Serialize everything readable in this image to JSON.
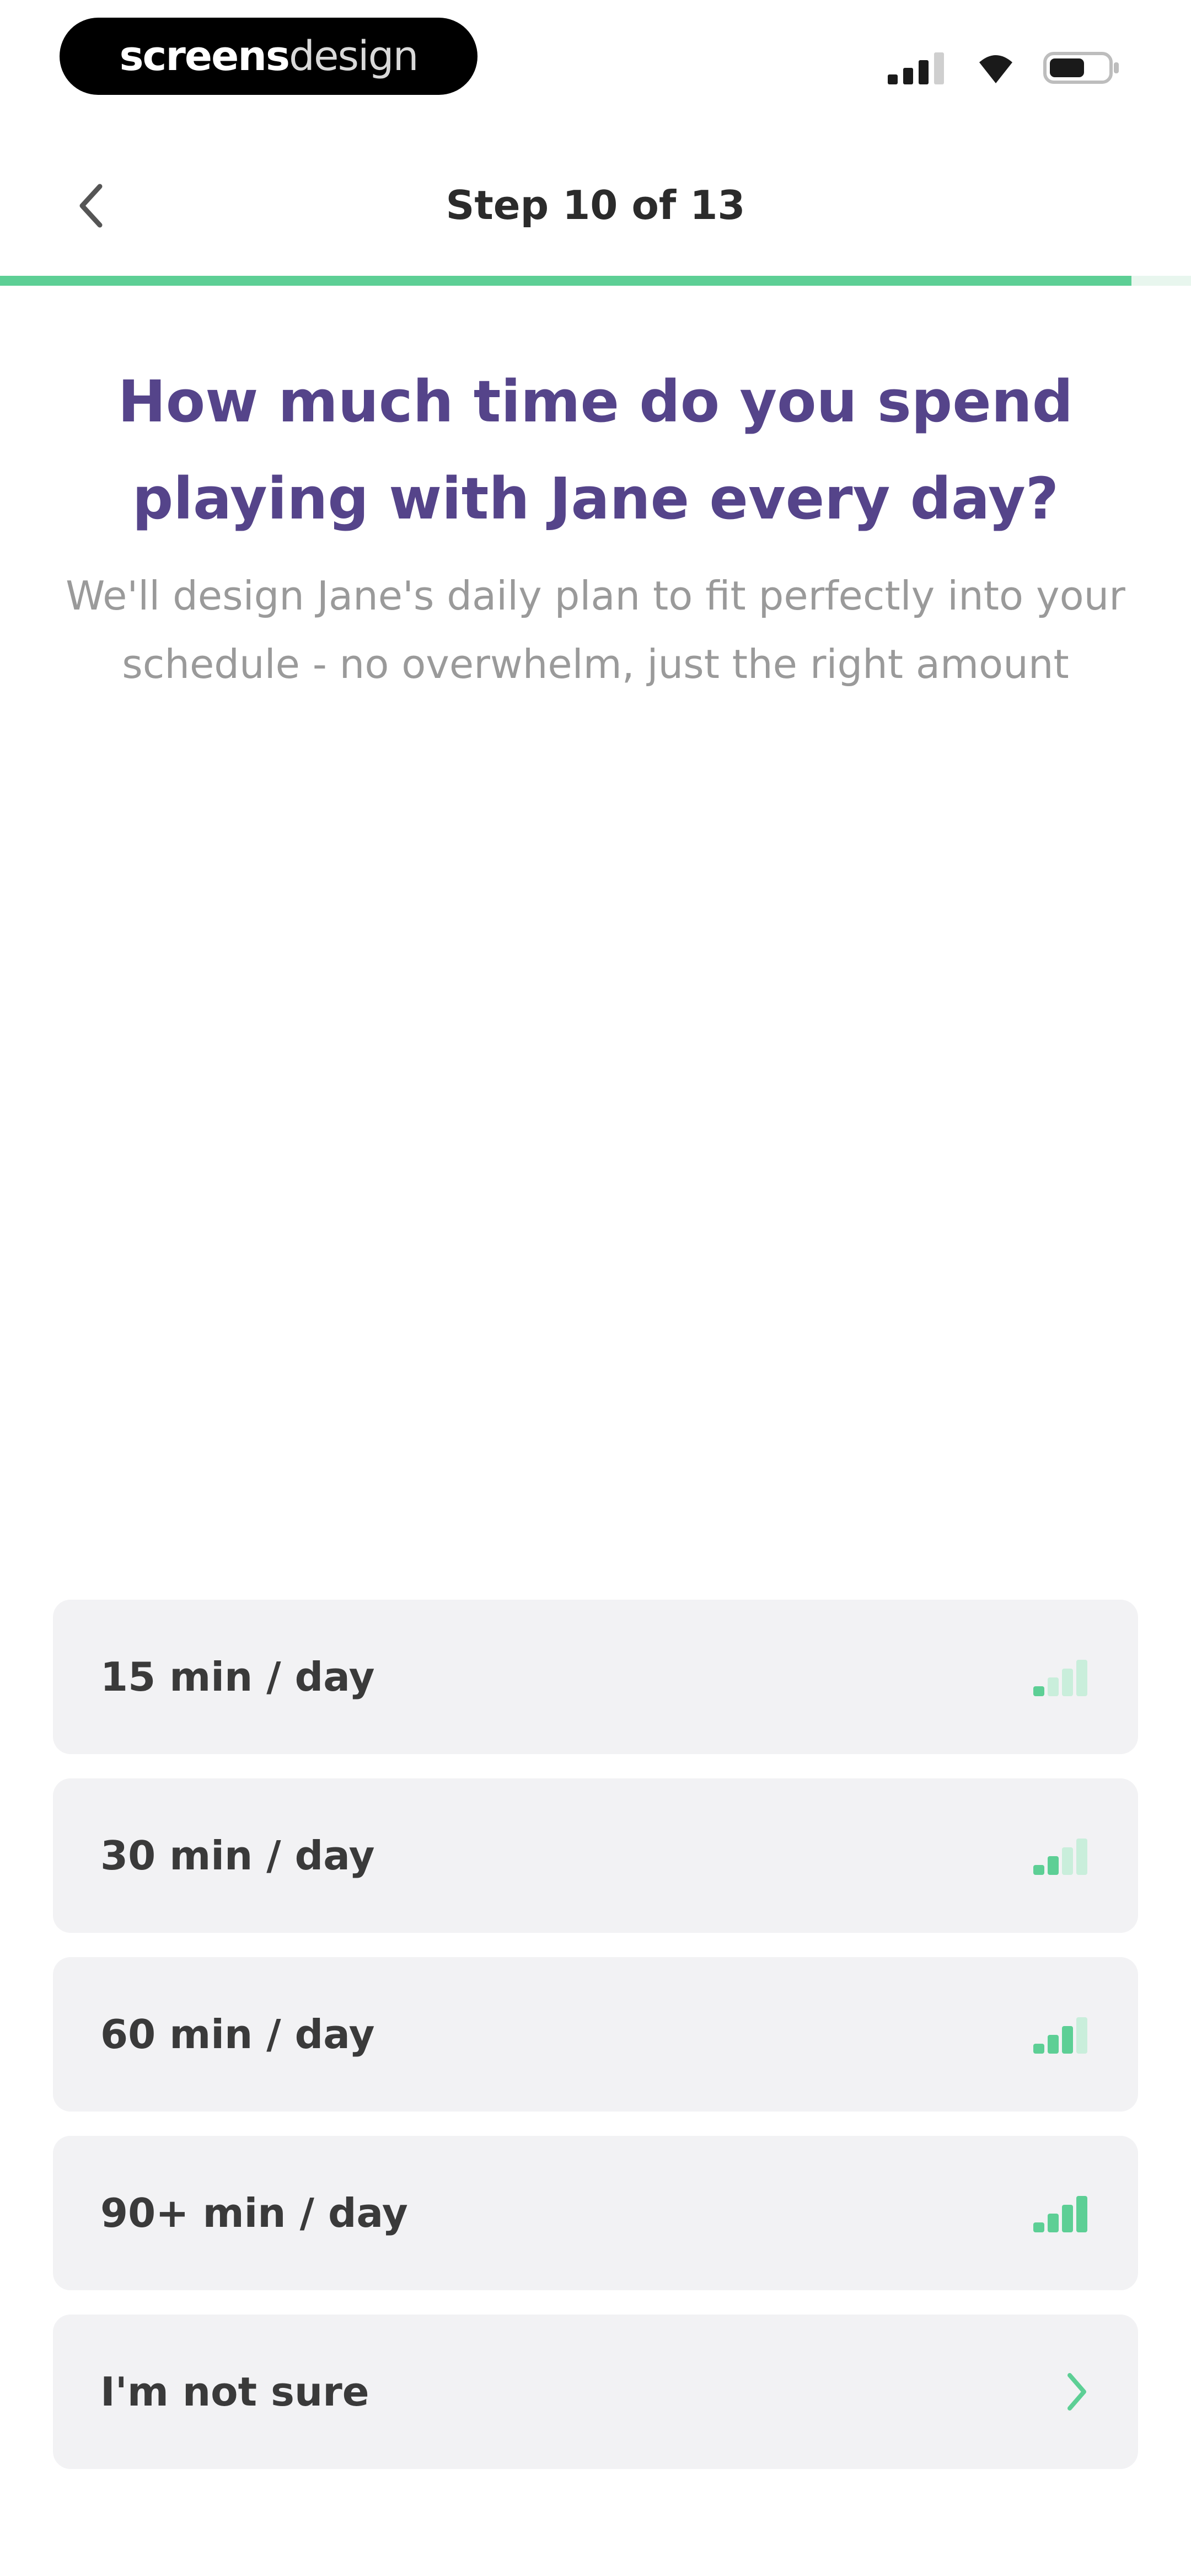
{
  "status_bar": {
    "brand_bold": "screens",
    "brand_light": "design",
    "signal_icon": "cellular-signal-icon",
    "wifi_icon": "wifi-icon",
    "battery_icon": "battery-icon"
  },
  "header": {
    "back_icon": "chevron-left-icon",
    "step_label": "Step 10 of 13",
    "progress_fraction": 0.95
  },
  "question": {
    "title": "How much time do you spend playing with Jane every day?",
    "subtitle": "We'll design Jane's daily plan to fit perfectly into your schedule - no overwhelm, just the right amount"
  },
  "options": [
    {
      "label": "15 min / day",
      "icon": "signal-bars-1-icon",
      "level": 1
    },
    {
      "label": "30 min / day",
      "icon": "signal-bars-2-icon",
      "level": 2
    },
    {
      "label": "60 min / day",
      "icon": "signal-bars-3-icon",
      "level": 3
    },
    {
      "label": "90+ min / day",
      "icon": "signal-bars-4-icon",
      "level": 4
    },
    {
      "label": "I'm not sure",
      "icon": "chevron-right-icon",
      "level": 0
    }
  ],
  "colors": {
    "accent_green": "#5dcf95",
    "accent_green_light": "#c9eedb",
    "title_purple": "#55448a",
    "option_bg": "#f2f2f4"
  }
}
